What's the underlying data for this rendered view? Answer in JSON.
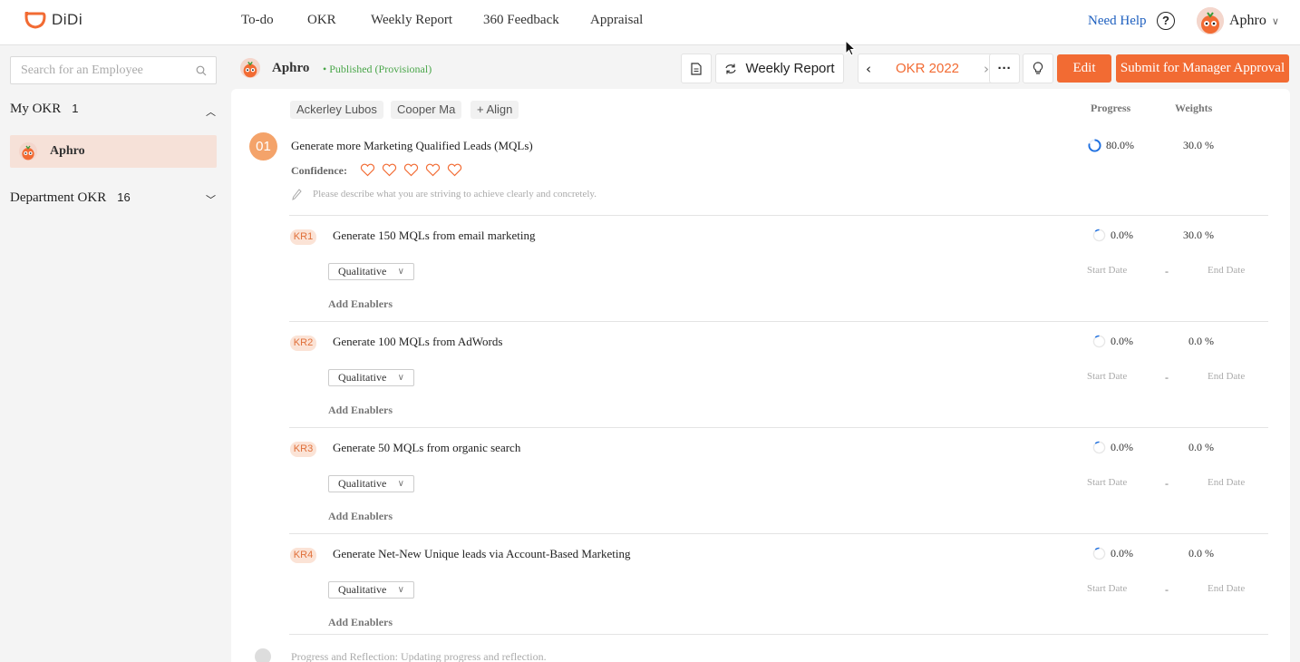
{
  "brand": {
    "name": "DiDi",
    "color": "#f26b33"
  },
  "nav": {
    "items": [
      "To-do",
      "OKR",
      "Weekly Report",
      "360 Feedback",
      "Appraisal"
    ],
    "help": "Need Help",
    "help_icon": "?",
    "user": "Aphro"
  },
  "sidebar": {
    "search_placeholder": "Search for an Employee",
    "my_okr": {
      "label": "My OKR",
      "count": "1"
    },
    "my_okr_user": "Aphro",
    "dept_okr": {
      "label": "Department OKR",
      "count": "16"
    }
  },
  "header": {
    "name": "Aphro",
    "status": "• Published (Provisional)",
    "weekly_report": "Weekly Report",
    "okr_year": "OKR 2022",
    "more": "···",
    "edit": "Edit",
    "submit": "Submit for Manager Approval"
  },
  "card": {
    "tags": [
      "Ackerley Lubos",
      "Cooper Ma",
      "+ Align"
    ],
    "col_progress": "Progress",
    "col_weights": "Weights",
    "objective": {
      "number": "01",
      "title": "Generate more Marketing Qualified Leads (MQLs)",
      "confidence_label": "Confidence:",
      "confidence_hearts": 5,
      "description_placeholder": "Please describe what you are striving to achieve clearly and concretely.",
      "progress": "80.0%",
      "progress_value": 0.8,
      "weight": "30.0 %"
    },
    "key_results": [
      {
        "badge": "KR1",
        "title": "Generate 150 MQLs from email marketing",
        "type": "Qualitative",
        "progress": "0.0%",
        "weight": "30.0 %",
        "start": "Start Date",
        "dash": "-",
        "end": "End Date",
        "enablers": "Add Enablers"
      },
      {
        "badge": "KR2",
        "title": "Generate 100 MQLs from AdWords",
        "type": "Qualitative",
        "progress": "0.0%",
        "weight": "0.0 %",
        "start": "Start Date",
        "dash": "-",
        "end": "End Date",
        "enablers": "Add Enablers"
      },
      {
        "badge": "KR3",
        "title": "Generate 50 MQLs from organic search",
        "type": "Qualitative",
        "progress": "0.0%",
        "weight": "0.0 %",
        "start": "Start Date",
        "dash": "-",
        "end": "End Date",
        "enablers": "Add Enablers"
      },
      {
        "badge": "KR4",
        "title": "Generate Net-New Unique leads via Account-Based Marketing",
        "type": "Qualitative",
        "progress": "0.0%",
        "weight": "0.0 %",
        "start": "Start Date",
        "dash": "-",
        "end": "End Date",
        "enablers": "Add Enablers"
      }
    ],
    "footer": "Progress and Reflection: Updating progress and reflection."
  }
}
